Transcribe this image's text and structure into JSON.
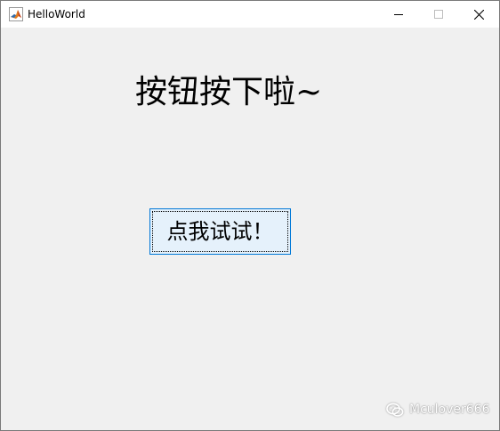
{
  "window": {
    "title": "HelloWorld",
    "icon": "matlab-icon",
    "controls": {
      "minimize": "minimize-icon",
      "maximize": "maximize-icon",
      "close": "close-icon"
    }
  },
  "figure": {
    "status_label": "按钮按下啦~",
    "button_label": "点我试试！"
  },
  "watermark": {
    "icon": "wechat-icon",
    "text": "Mculover666"
  },
  "colors": {
    "figure_background": "#f0f0f0",
    "button_background": "#e5f1fb",
    "button_border": "#0078d7",
    "titlebar_background": "#ffffff"
  }
}
